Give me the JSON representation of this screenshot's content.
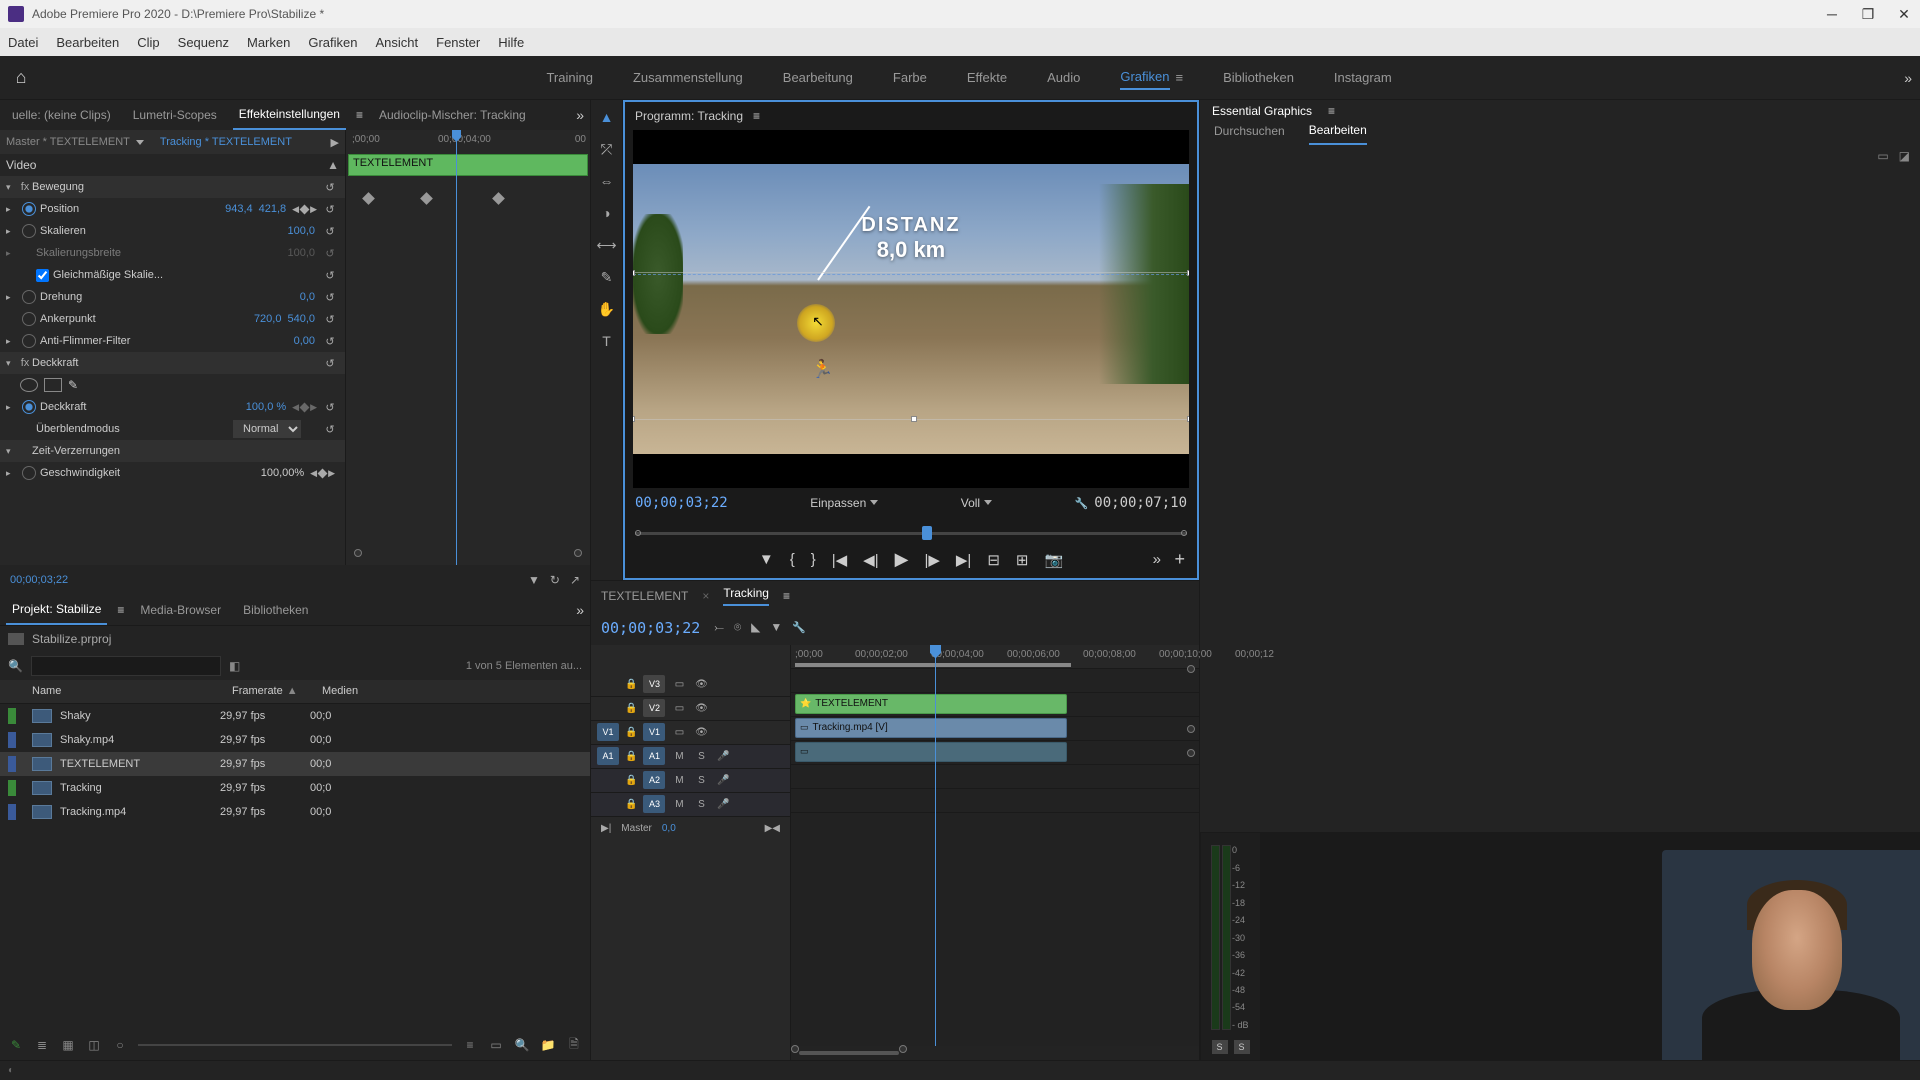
{
  "titlebar": {
    "title": "Adobe Premiere Pro 2020 - D:\\Premiere Pro\\Stabilize *"
  },
  "menu": {
    "datei": "Datei",
    "bearbeiten": "Bearbeiten",
    "clip": "Clip",
    "sequenz": "Sequenz",
    "marken": "Marken",
    "grafiken": "Grafiken",
    "ansicht": "Ansicht",
    "fenster": "Fenster",
    "hilfe": "Hilfe"
  },
  "workspaces": {
    "training": "Training",
    "zusammenstellung": "Zusammenstellung",
    "bearbeitung": "Bearbeitung",
    "farbe": "Farbe",
    "effekte": "Effekte",
    "audio": "Audio",
    "grafiken": "Grafiken",
    "bibliotheken": "Bibliotheken",
    "instagram": "Instagram"
  },
  "left_top_tabs": {
    "quelle": "uelle: (keine Clips)",
    "lumetri": "Lumetri-Scopes",
    "effekteinstellungen": "Effekteinstellungen",
    "audioclip": "Audioclip-Mischer: Tracking"
  },
  "ec": {
    "master": "Master * TEXTELEMENT",
    "track": "Tracking * TEXTELEMENT",
    "video_label": "Video",
    "bewegung": "Bewegung",
    "position": "Position",
    "pos_x": "943,4",
    "pos_y": "421,8",
    "skalieren": "Skalieren",
    "skal_val": "100,0",
    "skalierungsbreite": "Skalierungsbreite",
    "skb_val": "100,0",
    "gleichmassig": "Gleichmäßige Skalie...",
    "drehung": "Drehung",
    "dreh_val": "0,0",
    "ankerpunkt": "Ankerpunkt",
    "ank_x": "720,0",
    "ank_y": "540,0",
    "antiflimmer": "Anti-Flimmer-Filter",
    "af_val": "0,00",
    "deckkraft_grp": "Deckkraft",
    "deckkraft": "Deckkraft",
    "deck_val": "100,0 %",
    "blend": "Überblendmodus",
    "blend_val": "Normal",
    "zeit": "Zeit-Verzerrungen",
    "geschw": "Geschwindigkeit",
    "geschw_val": "100,00%",
    "clipbar": "TEXTELEMENT",
    "time_0": ";00;00",
    "time_4": "00;00;04;00",
    "time_end": "00",
    "footer_time": "00;00;03;22"
  },
  "project_tabs": {
    "projekt": "Projekt: Stabilize",
    "media": "Media-Browser",
    "bib": "Bibliotheken"
  },
  "project": {
    "title": "Stabilize.prproj",
    "info": "1 von 5 Elementen au...",
    "h_name": "Name",
    "h_fr": "Framerate",
    "h_med": "Medien",
    "items": [
      {
        "name": "Shaky",
        "fr": "29,97 fps",
        "med": "00;0",
        "color": "#3a8a3a"
      },
      {
        "name": "Shaky.mp4",
        "fr": "29,97 fps",
        "med": "00;0",
        "color": "#3a5a9a"
      },
      {
        "name": "TEXTELEMENT",
        "fr": "29,97 fps",
        "med": "00;0",
        "color": "#3a5a9a"
      },
      {
        "name": "Tracking",
        "fr": "29,97 fps",
        "med": "00;0",
        "color": "#3a8a3a"
      },
      {
        "name": "Tracking.mp4",
        "fr": "29,97 fps",
        "med": "00;0",
        "color": "#3a5a9a"
      }
    ]
  },
  "program": {
    "header": "Programm: Tracking",
    "overlay_label": "DISTANZ",
    "overlay_val": "8,0 km",
    "time": "00;00;03;22",
    "fit": "Einpassen",
    "zoom": "Voll",
    "dur": "00;00;07;10"
  },
  "timeline": {
    "tab1": "TEXTELEMENT",
    "tab2": "Tracking",
    "time": "00;00;03;22",
    "ruler": [
      ";00;00",
      "00;00;02;00",
      "00;00;04;00",
      "00;00;06;00",
      "00;00;08;00",
      "00;00;10;00",
      "00;00;12"
    ],
    "tracks": {
      "v3": "V3",
      "v2": "V2",
      "v1": "V1",
      "a1": "A1",
      "a2": "A2",
      "a3": "A3",
      "src_v1": "V1",
      "src_a1": "A1",
      "m": "M",
      "s": "S"
    },
    "clip1": "TEXTELEMENT",
    "clip2": "Tracking.mp4 [V]",
    "master": "Master",
    "master_val": "0,0"
  },
  "essential": {
    "title": "Essential Graphics",
    "durchsuchen": "Durchsuchen",
    "bearbeiten": "Bearbeiten"
  },
  "meters": {
    "scale": [
      "0",
      "-6",
      "-12",
      "-18",
      "-24",
      "-30",
      "-36",
      "-42",
      "-48",
      "-54",
      "- dB"
    ],
    "solo": "S"
  }
}
